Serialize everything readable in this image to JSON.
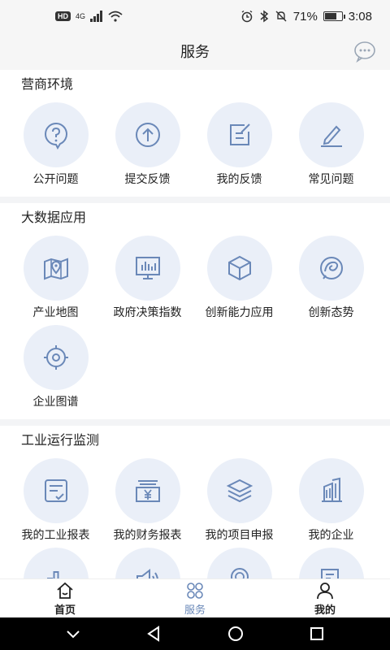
{
  "status_bar": {
    "left_badge": "HD",
    "network": "4G",
    "battery_percent": "71%",
    "battery_level": 0.71,
    "time": "3:08"
  },
  "header": {
    "title": "服务"
  },
  "sections": [
    {
      "title": "营商环境",
      "items": [
        {
          "label": "公开问题",
          "icon": "question-bubble-icon"
        },
        {
          "label": "提交反馈",
          "icon": "upload-arrow-icon"
        },
        {
          "label": "我的反馈",
          "icon": "edit-document-icon"
        },
        {
          "label": "常见问题",
          "icon": "pen-icon"
        }
      ]
    },
    {
      "title": "大数据应用",
      "items": [
        {
          "label": "产业地图",
          "icon": "map-pin-icon"
        },
        {
          "label": "政府决策指数",
          "icon": "monitor-chart-icon"
        },
        {
          "label": "创新能力应用",
          "icon": "cube-icon"
        },
        {
          "label": "创新态势",
          "icon": "swirl-circle-icon"
        },
        {
          "label": "企业图谱",
          "icon": "target-icon"
        }
      ]
    },
    {
      "title": "工业运行监测",
      "items": [
        {
          "label": "我的工业报表",
          "icon": "report-icon"
        },
        {
          "label": "我的财务报表",
          "icon": "finance-icon"
        },
        {
          "label": "我的项目申报",
          "icon": "layers-icon"
        },
        {
          "label": "我的企业",
          "icon": "building-icon"
        },
        {
          "label": "",
          "icon": "bar-chart-icon"
        },
        {
          "label": "",
          "icon": "speaker-icon"
        },
        {
          "label": "",
          "icon": "award-icon"
        },
        {
          "label": "",
          "icon": "search-document-icon"
        }
      ]
    }
  ],
  "tabs": [
    {
      "label": "首页",
      "icon": "home-icon"
    },
    {
      "label": "服务",
      "icon": "service-grid-icon"
    },
    {
      "label": "我的",
      "icon": "user-icon"
    }
  ],
  "colors": {
    "accent": "#6a88b8",
    "icon_bg": "#eaeff8"
  }
}
